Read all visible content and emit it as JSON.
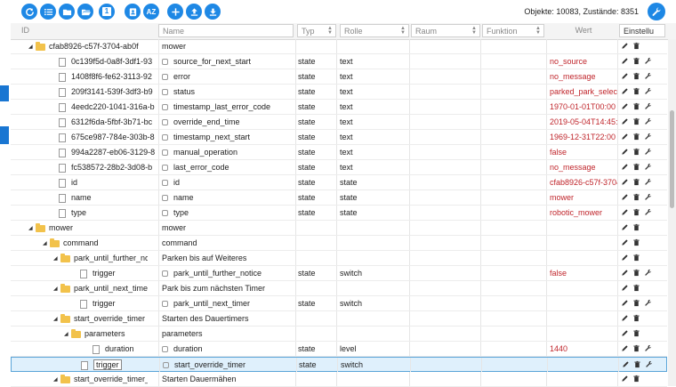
{
  "toolbar": {
    "buttons": [
      "refresh-icon",
      "list-icon",
      "folder-icon",
      "folder-open-icon",
      "number-one-icon",
      "clipboard-user-icon",
      "sort-az-icon",
      "add-icon",
      "upload-icon",
      "download-icon"
    ],
    "az_label": "AZ",
    "one_label": "1",
    "status": "Objekte: 10083, Zustände: 8351"
  },
  "columns": {
    "id": "ID",
    "name": "Name",
    "type": "Typ",
    "role": "Rolle",
    "room": "Raum",
    "function": "Funktion",
    "value": "Wert",
    "settings": "Einstellu"
  },
  "rows": [
    {
      "id": "cfab8926-c57f-3704-ab0f",
      "name": "mower",
      "type": "",
      "role": "",
      "value": "",
      "kind": "folder",
      "level": 0,
      "nameIcon": false,
      "actions": [
        "edit",
        "delete"
      ]
    },
    {
      "id": "0c139f5d-0a8f-3df1-93",
      "name": "source_for_next_start",
      "type": "state",
      "role": "text",
      "value": "no_source",
      "kind": "file",
      "level": 1,
      "nameIcon": true,
      "actions": [
        "edit",
        "delete",
        "config"
      ]
    },
    {
      "id": "1408f8f6-fe62-3113-92",
      "name": "error",
      "type": "state",
      "role": "text",
      "value": "no_message",
      "kind": "file",
      "level": 1,
      "nameIcon": true,
      "actions": [
        "edit",
        "delete",
        "config"
      ]
    },
    {
      "id": "209f3141-539f-3df3-b9",
      "name": "status",
      "type": "state",
      "role": "text",
      "value": "parked_park_select",
      "kind": "file",
      "level": 1,
      "nameIcon": true,
      "actions": [
        "edit",
        "delete",
        "config"
      ]
    },
    {
      "id": "4eedc220-1041-316a-b",
      "name": "timestamp_last_error_code",
      "type": "state",
      "role": "text",
      "value": "1970-01-01T00:00",
      "kind": "file",
      "level": 1,
      "nameIcon": true,
      "actions": [
        "edit",
        "delete",
        "config"
      ]
    },
    {
      "id": "6312f6da-5fbf-3b71-bc",
      "name": "override_end_time",
      "type": "state",
      "role": "text",
      "value": "2019-05-04T14:45:",
      "kind": "file",
      "level": 1,
      "nameIcon": true,
      "actions": [
        "edit",
        "delete",
        "config"
      ]
    },
    {
      "id": "675ce987-784e-303b-8",
      "name": "timestamp_next_start",
      "type": "state",
      "role": "text",
      "value": "1969-12-31T22:00",
      "kind": "file",
      "level": 1,
      "nameIcon": true,
      "actions": [
        "edit",
        "delete",
        "config"
      ]
    },
    {
      "id": "994a2287-eb06-3129-8",
      "name": "manual_operation",
      "type": "state",
      "role": "text",
      "value": "false",
      "kind": "file",
      "level": 1,
      "nameIcon": true,
      "actions": [
        "edit",
        "delete",
        "config"
      ]
    },
    {
      "id": "fc538572-28b2-3d08-b",
      "name": "last_error_code",
      "type": "state",
      "role": "text",
      "value": "no_message",
      "kind": "file",
      "level": 1,
      "nameIcon": true,
      "actions": [
        "edit",
        "delete",
        "config"
      ]
    },
    {
      "id": "id",
      "name": "id",
      "type": "state",
      "role": "state",
      "value": "cfab8926-c57f-3704",
      "kind": "file",
      "level": 1,
      "nameIcon": true,
      "actions": [
        "edit",
        "delete",
        "config"
      ]
    },
    {
      "id": "name",
      "name": "name",
      "type": "state",
      "role": "state",
      "value": "mower",
      "kind": "file",
      "level": 1,
      "nameIcon": true,
      "actions": [
        "edit",
        "delete",
        "config"
      ]
    },
    {
      "id": "type",
      "name": "type",
      "type": "state",
      "role": "state",
      "value": "robotic_mower",
      "kind": "file",
      "level": 1,
      "nameIcon": true,
      "actions": [
        "edit",
        "delete",
        "config"
      ]
    },
    {
      "id": "mower",
      "name": "mower",
      "type": "",
      "role": "",
      "value": "",
      "kind": "folder",
      "level": 0,
      "nameIcon": false,
      "actions": [
        "edit",
        "delete"
      ]
    },
    {
      "id": "command",
      "name": "command",
      "type": "",
      "role": "",
      "value": "",
      "kind": "folder",
      "level": 1,
      "nameIcon": false,
      "actions": [
        "edit",
        "delete"
      ]
    },
    {
      "id": "park_until_further_no",
      "name": "Parken bis auf Weiteres",
      "type": "",
      "role": "",
      "value": "",
      "kind": "folder",
      "level": 2,
      "nameIcon": false,
      "actions": [
        "edit",
        "delete"
      ]
    },
    {
      "id": "trigger",
      "name": "park_until_further_notice",
      "type": "state",
      "role": "switch",
      "value": "false",
      "kind": "file",
      "level": 3,
      "nameIcon": true,
      "actions": [
        "edit",
        "delete",
        "config"
      ]
    },
    {
      "id": "park_until_next_timer",
      "name": "Park bis zum nächsten Timer",
      "type": "",
      "role": "",
      "value": "",
      "kind": "folder",
      "level": 2,
      "nameIcon": false,
      "actions": [
        "edit",
        "delete"
      ]
    },
    {
      "id": "trigger",
      "name": "park_until_next_timer",
      "type": "state",
      "role": "switch",
      "value": "",
      "kind": "file",
      "level": 3,
      "nameIcon": true,
      "actions": [
        "edit",
        "delete",
        "config"
      ]
    },
    {
      "id": "start_override_timer",
      "name": "Starten des Dauertimers",
      "type": "",
      "role": "",
      "value": "",
      "kind": "folder",
      "level": 2,
      "nameIcon": false,
      "actions": [
        "edit",
        "delete"
      ]
    },
    {
      "id": "parameters",
      "name": "parameters",
      "type": "",
      "role": "",
      "value": "",
      "kind": "folder",
      "level": 3,
      "nameIcon": false,
      "actions": [
        "edit",
        "delete"
      ]
    },
    {
      "id": "duration",
      "name": "duration",
      "type": "state",
      "role": "level",
      "value": "1440",
      "kind": "file",
      "level": 4,
      "nameIcon": true,
      "actions": [
        "edit",
        "delete",
        "config"
      ]
    },
    {
      "id": "trigger",
      "name": "start_override_timer",
      "type": "state",
      "role": "switch",
      "value": "",
      "kind": "file",
      "level": 3,
      "nameIcon": true,
      "actions": [
        "edit",
        "delete",
        "config"
      ],
      "selected": true
    },
    {
      "id": "start_override_timer_s",
      "name": "Starten Dauermähen",
      "type": "",
      "role": "",
      "value": "",
      "kind": "folder",
      "level": 2,
      "nameIcon": false,
      "actions": [
        "edit",
        "delete"
      ]
    }
  ]
}
